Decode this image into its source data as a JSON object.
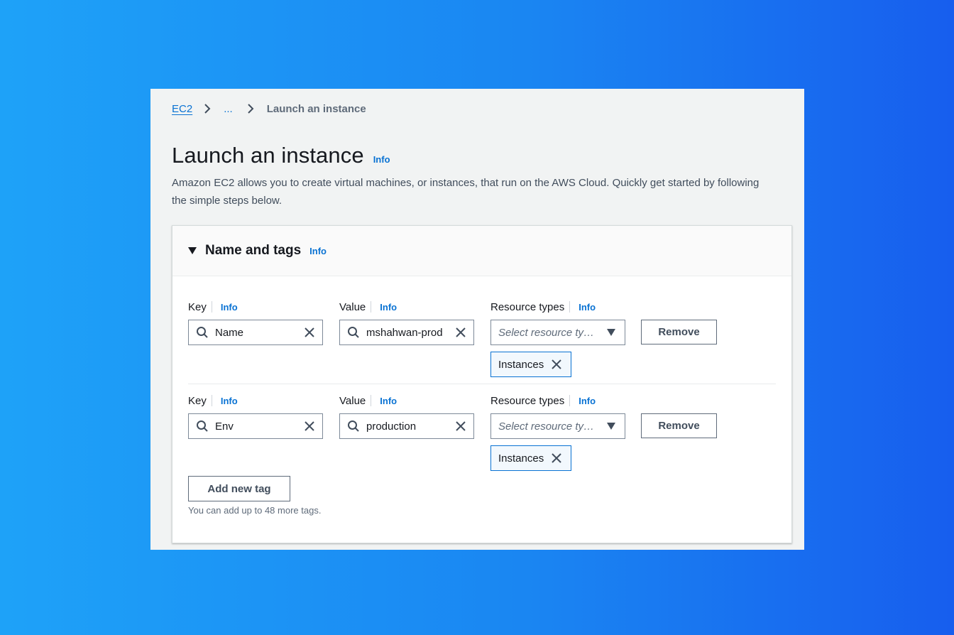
{
  "breadcrumb": {
    "root": "EC2",
    "ellipsis": "...",
    "current": "Launch an instance"
  },
  "page": {
    "title": "Launch an instance",
    "info": "Info",
    "description": "Amazon EC2 allows you to create virtual machines, or instances, that run on the AWS Cloud. Quickly get started by following the simple steps below."
  },
  "section": {
    "title": "Name and tags",
    "info": "Info",
    "expanded": true
  },
  "labels": {
    "key": "Key",
    "value": "Value",
    "resource_types": "Resource types",
    "info": "Info"
  },
  "tags": [
    {
      "key": "Name",
      "value": "mshahwan-prod",
      "resource_placeholder": "Select resource ty…",
      "token": "Instances",
      "remove": "Remove"
    },
    {
      "key": "Env",
      "value": "production",
      "resource_placeholder": "Select resource ty…",
      "token": "Instances",
      "remove": "Remove"
    }
  ],
  "actions": {
    "add_new_tag": "Add new tag",
    "hint": "You can add up to 48 more tags."
  },
  "colors": {
    "link": "#0972d3",
    "text": "#16191f",
    "secondary_text": "#5f6b7a",
    "page_bg": "#f1f3f3",
    "gradient_start": "#1ea2f8",
    "gradient_end": "#175eee"
  },
  "icons": [
    "chevron-right-icon",
    "caret-down-icon",
    "search-icon",
    "close-icon",
    "dropdown-icon"
  ]
}
